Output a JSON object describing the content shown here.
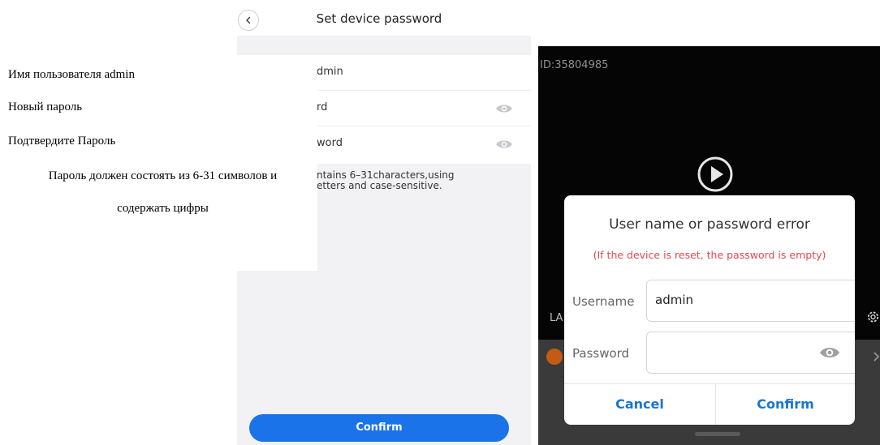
{
  "left_screen": {
    "title": "Set device password",
    "username_value": "dmin",
    "new_password_label": "rd",
    "confirm_password_label": "word",
    "hint_line1": "ntains 6–31characters,using",
    "hint_line2": "etters and case-sensitive.",
    "confirm_button": "Confirm",
    "icons": {
      "back": "chevron-left-icon",
      "show_password": "eye-icon"
    }
  },
  "overlay_ru": {
    "username_line": "Имя пользователя admin",
    "new_password_line": "Новый пароль",
    "confirm_password_line": "Подтвердите Пароль",
    "hint_line1": "Пароль должен состоять из 6-31 символов и",
    "hint_line2": "содержать цифры"
  },
  "right_screen": {
    "device_id": "ID:35804985",
    "partial_label": "LA",
    "icons": {
      "play": "play-circle-icon",
      "settings": "gear-icon",
      "chevron": "chevron-right-icon"
    },
    "dialog": {
      "title": "User name or password error",
      "warning": "(If the device is reset, the password is empty)",
      "username_label": "Username",
      "username_value": "admin",
      "password_label": "Password",
      "password_value": "",
      "cancel_button": "Cancel",
      "confirm_button": "Confirm"
    }
  },
  "colors": {
    "accent_blue": "#1a73e8",
    "dialog_button_blue": "#1976d2",
    "warning_red": "#e5484d"
  }
}
